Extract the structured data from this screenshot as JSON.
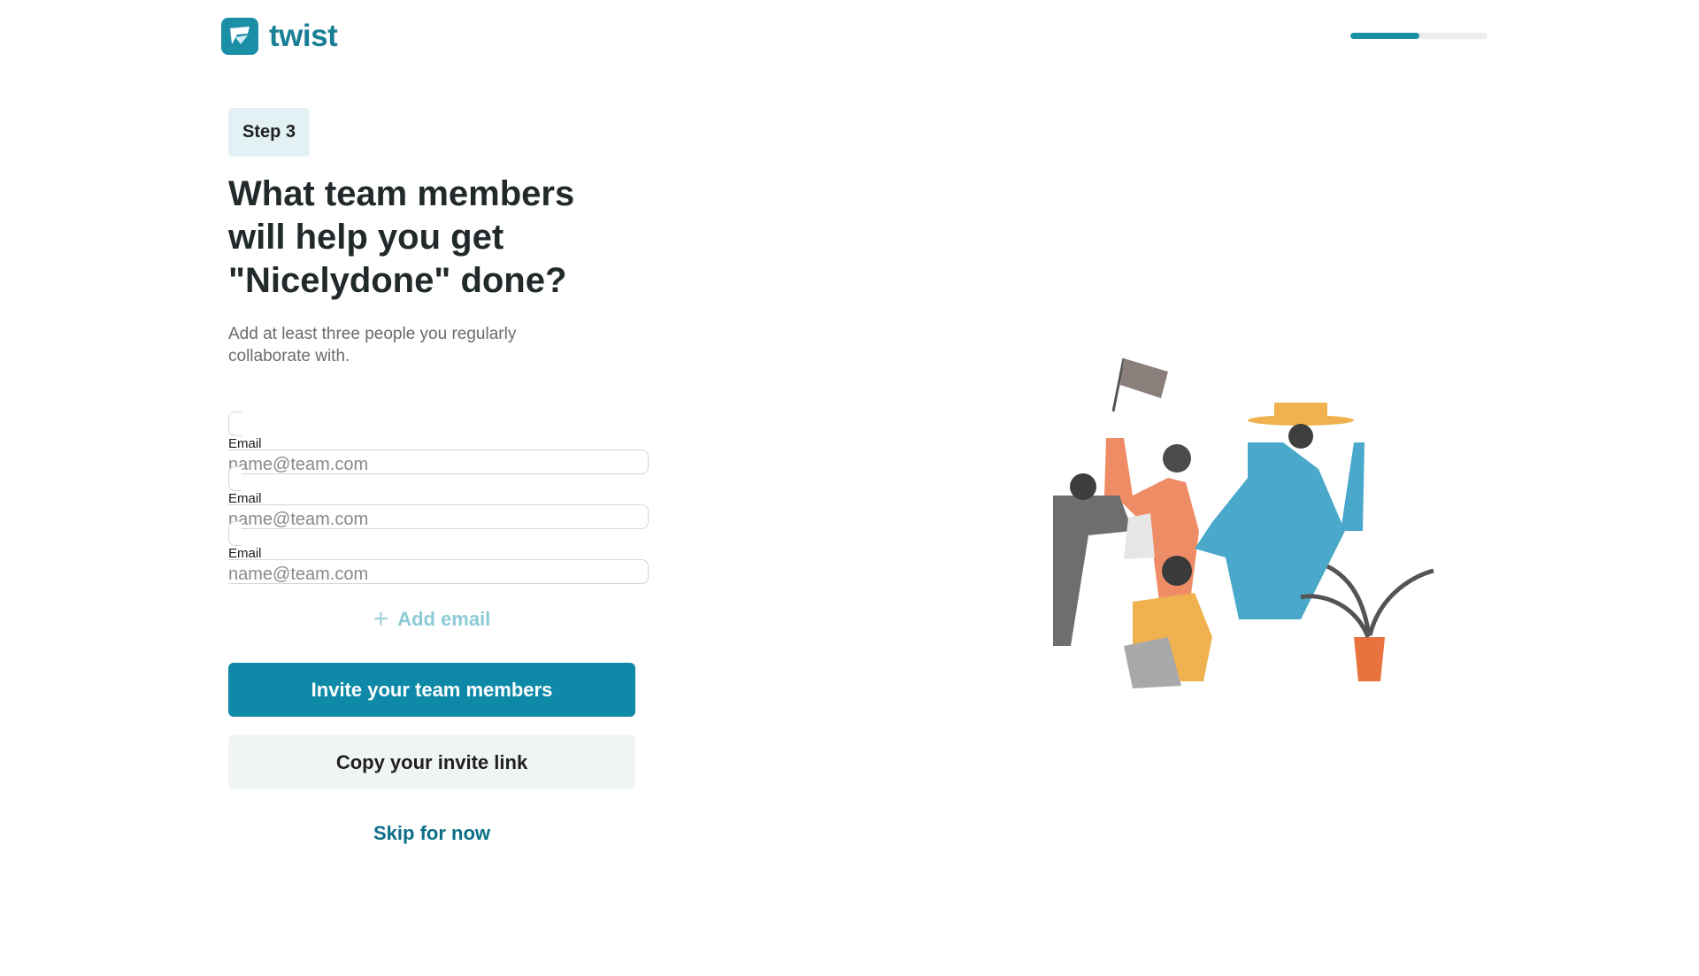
{
  "brand": {
    "name": "twist",
    "logo_icon": "twist-logo-icon"
  },
  "progress": {
    "fraction": 0.5
  },
  "step": {
    "label": "Step 3"
  },
  "heading": "What team members will help you get \"Nicelydone\" done?",
  "subheading": "Add at least three people you regularly collaborate with.",
  "email_fields": [
    {
      "label": "Email",
      "placeholder": "name@team.com",
      "value": ""
    },
    {
      "label": "Email",
      "placeholder": "name@team.com",
      "value": ""
    },
    {
      "label": "Email",
      "placeholder": "name@team.com",
      "value": ""
    }
  ],
  "add_email": {
    "icon": "plus-icon",
    "label": "Add email"
  },
  "buttons": {
    "invite": "Invite your team members",
    "copy_link": "Copy your invite link",
    "skip": "Skip for now"
  },
  "colors": {
    "brand": "#1a8fa6",
    "primary_button": "#0e8aa8",
    "secondary_button": "#f1f4f5",
    "link": "#0b6f87"
  },
  "illustration": {
    "icon": "team-collage-illustration"
  }
}
